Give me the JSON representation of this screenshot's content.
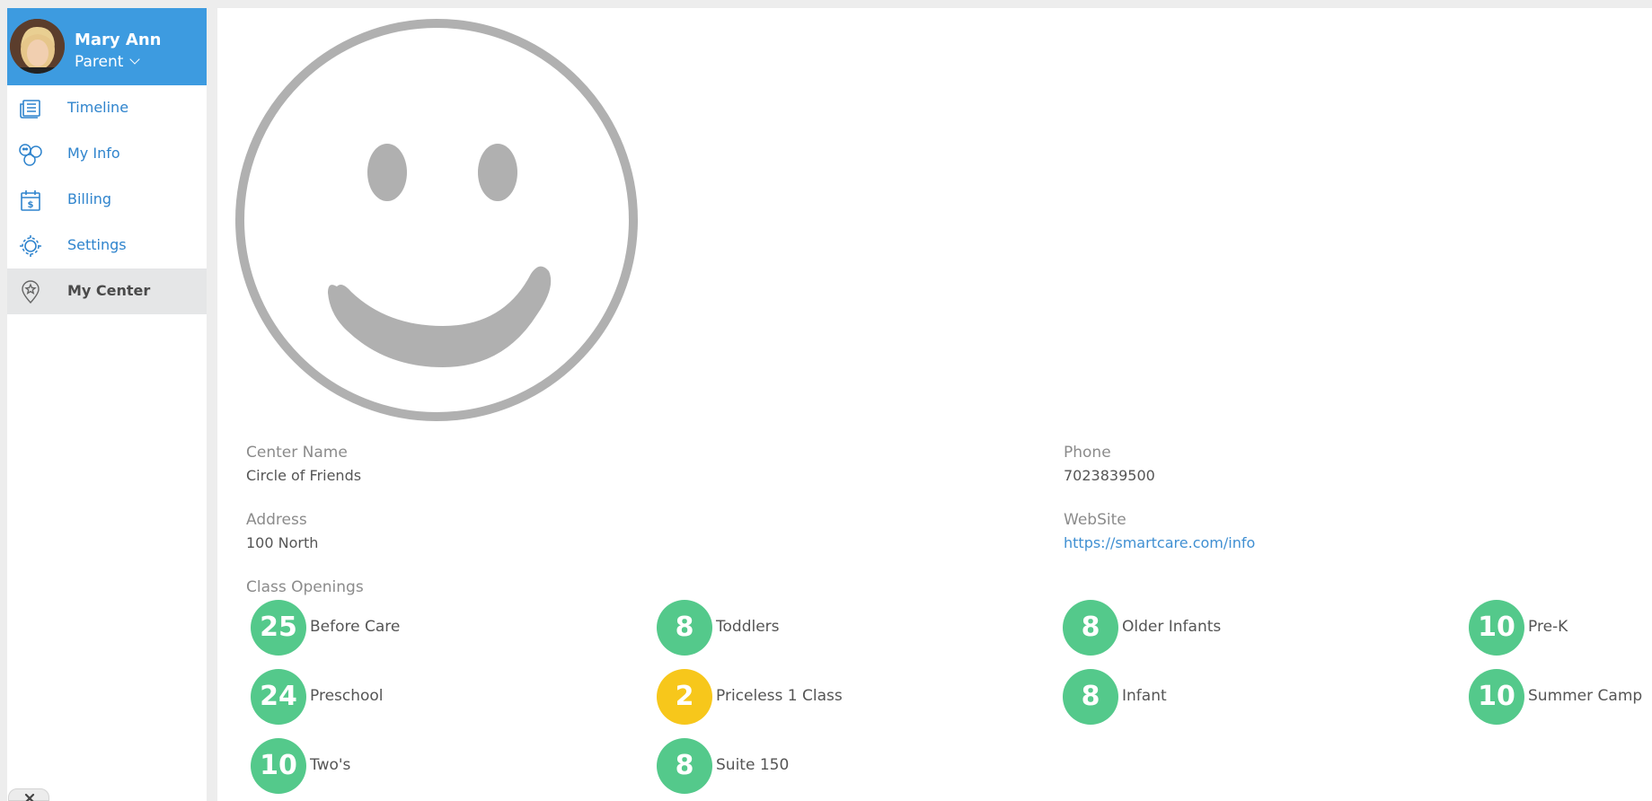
{
  "user": {
    "name": "Mary Ann",
    "role": "Parent"
  },
  "nav": [
    {
      "label": "Timeline",
      "icon": "timeline-icon"
    },
    {
      "label": "My Info",
      "icon": "my-info-icon"
    },
    {
      "label": "Billing",
      "icon": "billing-icon"
    },
    {
      "label": "Settings",
      "icon": "settings-icon"
    },
    {
      "label": "My Center",
      "icon": "my-center-icon",
      "active": true
    }
  ],
  "center": {
    "name_label": "Center Name",
    "name": "Circle of Friends",
    "address_label": "Address",
    "address": "100 North",
    "phone_label": "Phone",
    "phone": "7023839500",
    "website_label": "WebSite",
    "website": "https://smartcare.com/info",
    "openings_label": "Class Openings"
  },
  "openings": [
    {
      "count": "25",
      "label": "Before Care",
      "color": "#54c98b"
    },
    {
      "count": "8",
      "label": "Toddlers",
      "color": "#54c98b"
    },
    {
      "count": "8",
      "label": "Older Infants",
      "color": "#54c98b"
    },
    {
      "count": "10",
      "label": "Pre-K",
      "color": "#54c98b"
    },
    {
      "count": "24",
      "label": "Preschool",
      "color": "#54c98b"
    },
    {
      "count": "2",
      "label": "Priceless 1 Class",
      "color": "#f7c71b"
    },
    {
      "count": "8",
      "label": "Infant",
      "color": "#54c98b"
    },
    {
      "count": "10",
      "label": "Summer Camp",
      "color": "#54c98b"
    },
    {
      "count": "10",
      "label": "Two's",
      "color": "#54c98b"
    },
    {
      "count": "8",
      "label": "Suite 150",
      "color": "#54c98b"
    }
  ],
  "colors": {
    "accent": "#3d9be0",
    "open": "#54c98b",
    "limited": "#f7c71b",
    "link": "#2f84cd"
  }
}
